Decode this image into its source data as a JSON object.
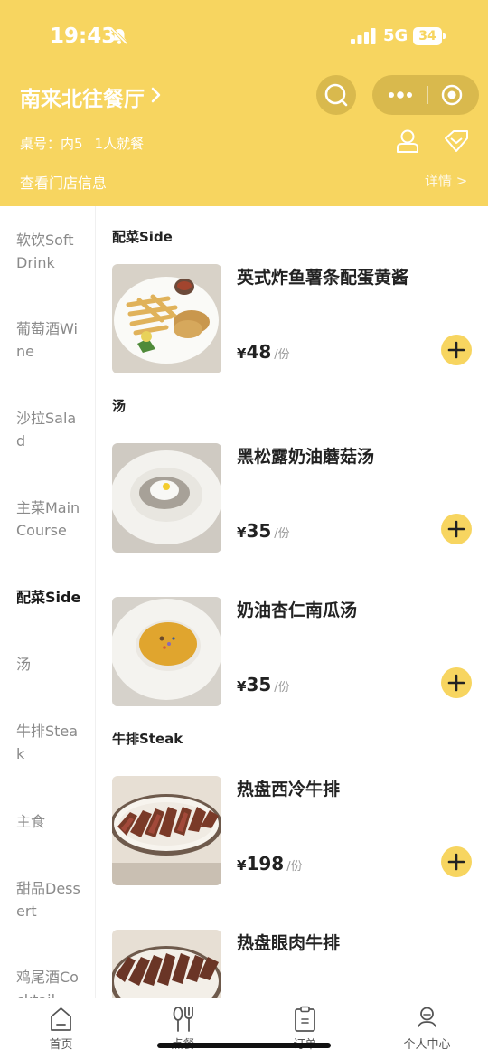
{
  "status_bar": {
    "time": "19:43",
    "network": "5G",
    "battery": "34"
  },
  "header": {
    "store_name": "南来北往餐厅",
    "table_label": "桌号：内5",
    "diners": "1人就餐",
    "store_info_link": "查看门店信息",
    "details_link": "详情 >"
  },
  "sidebar": {
    "categories": [
      {
        "label": "软饮Soft Drink",
        "active": false
      },
      {
        "label": "葡萄酒Wine",
        "active": false
      },
      {
        "label": "沙拉Salad",
        "active": false
      },
      {
        "label": "主菜Main Course",
        "active": false
      },
      {
        "label": "配菜Side",
        "active": true
      },
      {
        "label": "汤",
        "active": false
      },
      {
        "label": "牛排Steak",
        "active": false
      },
      {
        "label": "主食",
        "active": false
      },
      {
        "label": "甜品Dessert",
        "active": false
      },
      {
        "label": "鸡尾酒Cocktail",
        "active": false
      }
    ]
  },
  "menu": {
    "sections": [
      {
        "title": "配菜Side"
      },
      {
        "title": "汤"
      },
      {
        "title": "牛排Steak"
      }
    ],
    "items": [
      {
        "name": "英式炸鱼薯条配蛋黄酱",
        "currency": "¥",
        "price": "48",
        "unit": "/份"
      },
      {
        "name": "黑松露奶油蘑菇汤",
        "currency": "¥",
        "price": "35",
        "unit": "/份"
      },
      {
        "name": "奶油杏仁南瓜汤",
        "currency": "¥",
        "price": "35",
        "unit": "/份"
      },
      {
        "name": "热盘西冷牛排",
        "currency": "¥",
        "price": "198",
        "unit": "/份"
      },
      {
        "name": "热盘眼肉牛排",
        "currency": "¥",
        "price": "",
        "unit": ""
      }
    ]
  },
  "tabbar": {
    "tabs": [
      {
        "label": "首页",
        "icon": "home-icon"
      },
      {
        "label": "点餐",
        "icon": "cutlery-icon"
      },
      {
        "label": "订单",
        "icon": "order-icon"
      },
      {
        "label": "个人中心",
        "icon": "profile-icon"
      }
    ]
  },
  "colors": {
    "brand_yellow": "#f7d560",
    "capsule": "#d9b94d",
    "text_dark": "#1a1a1a",
    "text_muted": "#8a8a8a"
  }
}
